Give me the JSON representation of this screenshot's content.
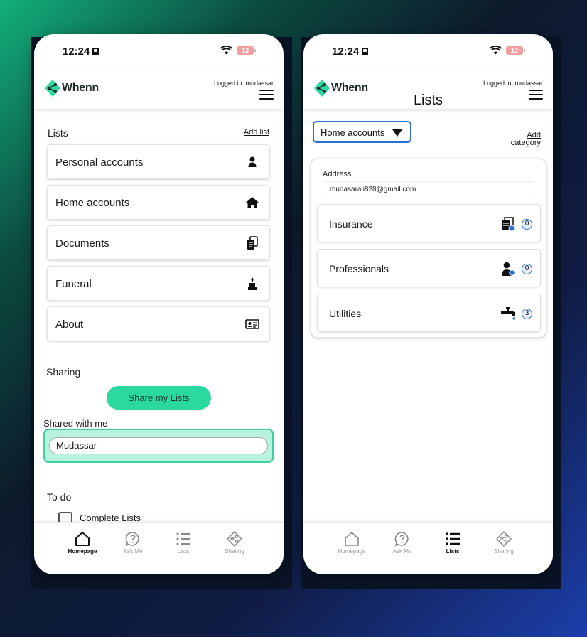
{
  "status": {
    "time": "12:24",
    "battery": "13"
  },
  "brand": {
    "name": "Whenn"
  },
  "header": {
    "logged_in": "Logged in: mudassar"
  },
  "home": {
    "lists_label": "Lists",
    "add_list": "Add list",
    "lists": [
      {
        "label": "Personal accounts",
        "icon": "person-icon"
      },
      {
        "label": "Home accounts",
        "icon": "house-icon"
      },
      {
        "label": "Documents",
        "icon": "documents-icon"
      },
      {
        "label": "Funeral",
        "icon": "urn-icon"
      },
      {
        "label": "About",
        "icon": "id-card-icon"
      }
    ],
    "sharing_label": "Sharing",
    "share_button": "Share my Lists",
    "shared_with_label": "Shared with me",
    "shared_with": [
      "Mudassar"
    ],
    "todo_label": "To do",
    "todo_items": [
      {
        "label": "Complete Lists",
        "checked": false
      }
    ]
  },
  "lists_screen": {
    "title": "Lists",
    "dropdown_value": "Home accounts",
    "add_category": "Add\ncategory",
    "address_label": "Address",
    "address_value": "mudasarali828@gmail.com",
    "categories": [
      {
        "label": "Insurance",
        "icon": "insurance-icon",
        "count": "0"
      },
      {
        "label": "Professionals",
        "icon": "professional-icon",
        "count": "0"
      },
      {
        "label": "Utilities",
        "icon": "faucet-icon",
        "count": "3"
      }
    ]
  },
  "tabs": [
    {
      "label": "Homepage",
      "icon": "home-icon"
    },
    {
      "label": "Ask Me",
      "icon": "question-bubble-icon"
    },
    {
      "label": "Lists",
      "icon": "list-icon"
    },
    {
      "label": "Sharing",
      "icon": "share-icon"
    }
  ],
  "colors": {
    "accent": "#2bd9a0",
    "dropdown_border": "#2a6fd4"
  }
}
